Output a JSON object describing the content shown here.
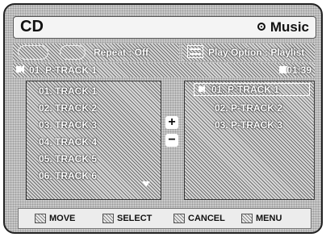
{
  "title_bar": {
    "mode": "CD",
    "media_type": "Music",
    "media_icon": "disc-icon"
  },
  "options": {
    "repeat": "Repeat : Off",
    "play_option": "Play Option : Playlist"
  },
  "status": {
    "now_playing": "01. P-TRACK 1",
    "time": "01:39"
  },
  "track_list": [
    "01. TRACK 1",
    "02. TRACK 2",
    "03. TRACK 3",
    "04. TRACK 4",
    "05. TRACK 5",
    "06. TRACK 6"
  ],
  "playlist": [
    "01. P-TRACK 1",
    "02. P-TRACK 2",
    "03. P-TRACK 3"
  ],
  "controls": {
    "add_symbol": "+",
    "remove_symbol": "−"
  },
  "bottom_keys": {
    "move": "MOVE",
    "select": "SELECT",
    "cancel": "CANCEL",
    "menu": "MENU"
  }
}
